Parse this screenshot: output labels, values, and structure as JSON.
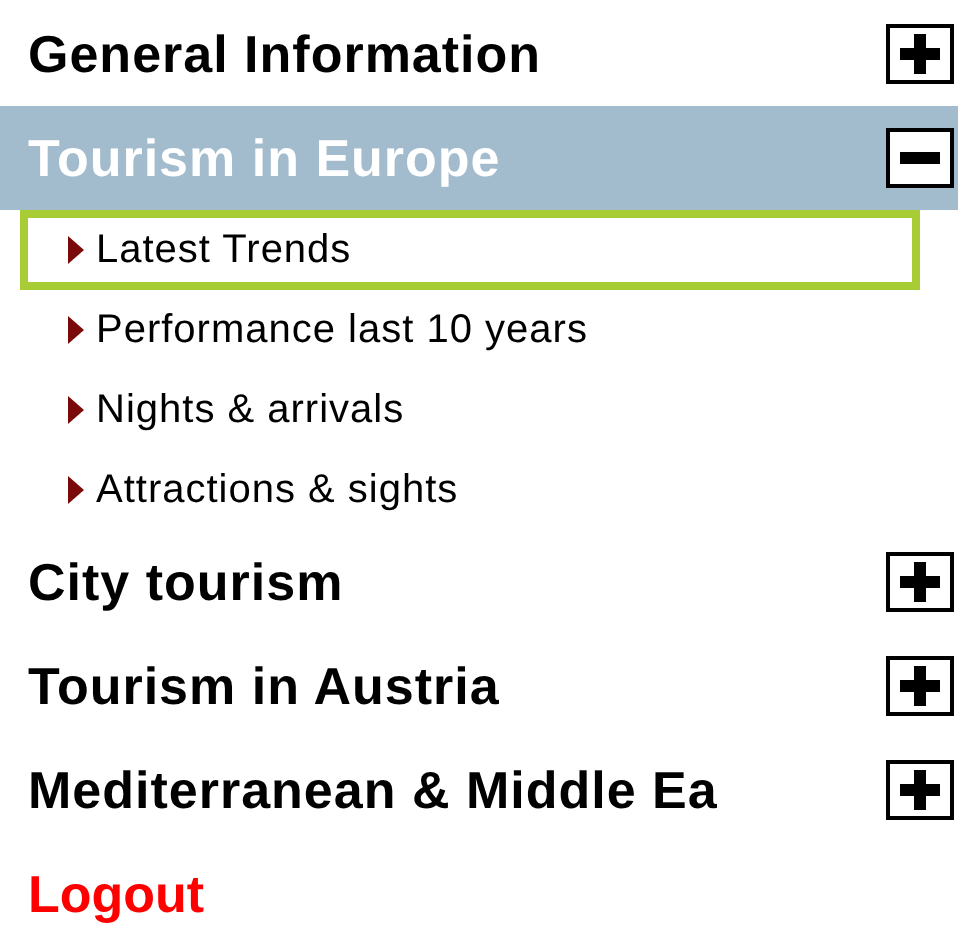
{
  "menu": [
    {
      "label": "General Information",
      "expanded": false
    },
    {
      "label": "Tourism in Europe",
      "expanded": true,
      "children": [
        {
          "label": "Latest Trends",
          "selected": true
        },
        {
          "label": "Performance last 10 years",
          "selected": false
        },
        {
          "label": "Nights & arrivals",
          "selected": false
        },
        {
          "label": "Attractions & sights",
          "selected": false
        }
      ]
    },
    {
      "label": "City tourism",
      "expanded": false
    },
    {
      "label": "Tourism in Austria",
      "expanded": false
    },
    {
      "label": "Mediterranean & Middle Ea",
      "expanded": false
    }
  ],
  "logout": "Logout"
}
